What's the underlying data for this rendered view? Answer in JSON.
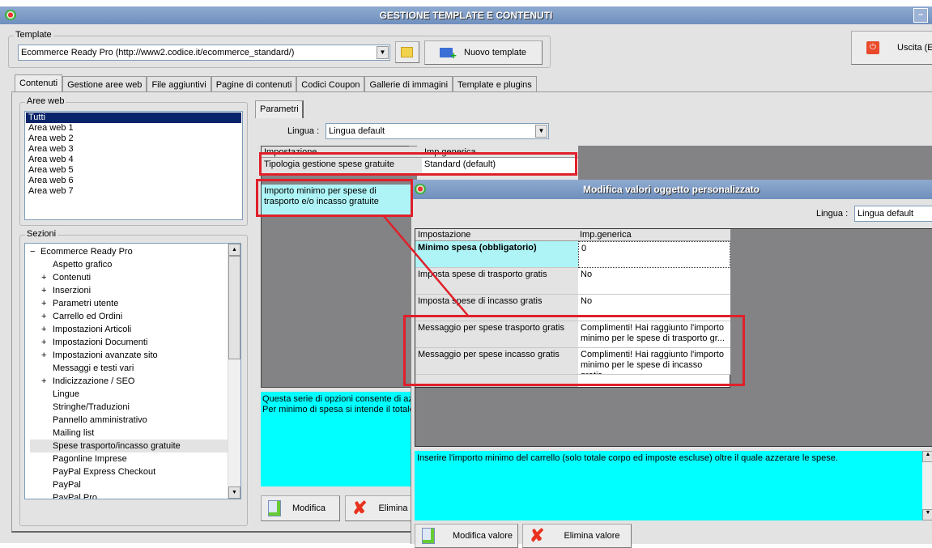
{
  "window": {
    "title": "GESTIONE TEMPLATE E CONTENUTI"
  },
  "template": {
    "group_label": "Template",
    "selected": "Ecommerce Ready Pro (http://www2.codice.it/ecommerce_standard/)",
    "new_button": "Nuovo template",
    "exit_button": "Uscita (ES"
  },
  "tabs": [
    "Contenuti",
    "Gestione aree web",
    "File aggiuntivi",
    "Pagine di contenuti",
    "Codici Coupon",
    "Gallerie di immagini",
    "Template e plugins"
  ],
  "aree_web": {
    "label": "Aree web",
    "items": [
      "Tutti",
      "Area web 1",
      "Area web 2",
      "Area web 3",
      "Area web 4",
      "Area web 5",
      "Area web 6",
      "Area web 7"
    ]
  },
  "sezioni": {
    "label": "Sezioni",
    "root": "Ecommerce Ready Pro",
    "items": [
      {
        "label": "Aspetto grafico",
        "exp": false
      },
      {
        "label": "Contenuti",
        "exp": true
      },
      {
        "label": "Inserzioni",
        "exp": true
      },
      {
        "label": "Parametri utente",
        "exp": true
      },
      {
        "label": "Carrello ed Ordini",
        "exp": true
      },
      {
        "label": "Impostazioni Articoli",
        "exp": true
      },
      {
        "label": "Impostazioni Documenti",
        "exp": true
      },
      {
        "label": "Impostazioni avanzate sito",
        "exp": true
      },
      {
        "label": "Messaggi e testi vari",
        "exp": false
      },
      {
        "label": "Indicizzazione / SEO",
        "exp": true
      },
      {
        "label": "Lingue",
        "exp": false
      },
      {
        "label": "Stringhe/Traduzioni",
        "exp": false
      },
      {
        "label": "Pannello amministrativo",
        "exp": false
      },
      {
        "label": "Mailing list",
        "exp": false
      },
      {
        "label": "Spese trasporto/incasso gratuite",
        "exp": false
      },
      {
        "label": "Pagonline Imprese",
        "exp": false
      },
      {
        "label": "PayPal Express Checkout",
        "exp": false
      },
      {
        "label": "PayPal",
        "exp": false
      },
      {
        "label": "PayPal Pro",
        "exp": false
      }
    ]
  },
  "parametri": {
    "tab": "Parametri",
    "lingua_label": "Lingua :",
    "lingua_value": "Lingua default",
    "headers": [
      "Impostazione",
      "Imp.generica"
    ],
    "rows": [
      {
        "name": "Tipologia gestione spese gratuite",
        "value": "Standard (default)"
      },
      {
        "name": "Importo minimo per spese di trasporto e/o incasso gratuite",
        "value": ""
      }
    ],
    "description_lines": [
      "Questa serie di opzioni consente di az",
      "Per minimo di spesa si intende il totale"
    ],
    "modify_button": "Modifica",
    "delete_button": "Elimina"
  },
  "dialog": {
    "title": "Modifica valori oggetto personalizzato",
    "lingua_label": "Lingua :",
    "lingua_value": "Lingua default",
    "headers": [
      "Impostazione",
      "Imp.generica"
    ],
    "rows": [
      {
        "name": "Minimo spesa (obbligatorio)",
        "value": "0"
      },
      {
        "name": "Imposta spese di trasporto gratis",
        "value": "No"
      },
      {
        "name": "Imposta spese di incasso gratis",
        "value": "No"
      },
      {
        "name": "Messaggio per spese trasporto gratis",
        "value": "Complimenti! Hai raggiunto l'importo minimo per le spese di trasporto gr..."
      },
      {
        "name": "Messaggio per spese incasso gratis",
        "value": "Complimenti! Hai raggiunto l'importo minimo per le spese di incasso gratis.."
      }
    ],
    "description": "Inserire l'importo minimo del carrello (solo totale corpo ed imposte escluse) oltre il quale azzerare le spese.",
    "modify_button": "Modifica valore",
    "delete_button": "Elimina valore"
  },
  "colors": {
    "highlight": "#e0202a",
    "cyan": "#00ffff",
    "selected": "#0a246a"
  }
}
